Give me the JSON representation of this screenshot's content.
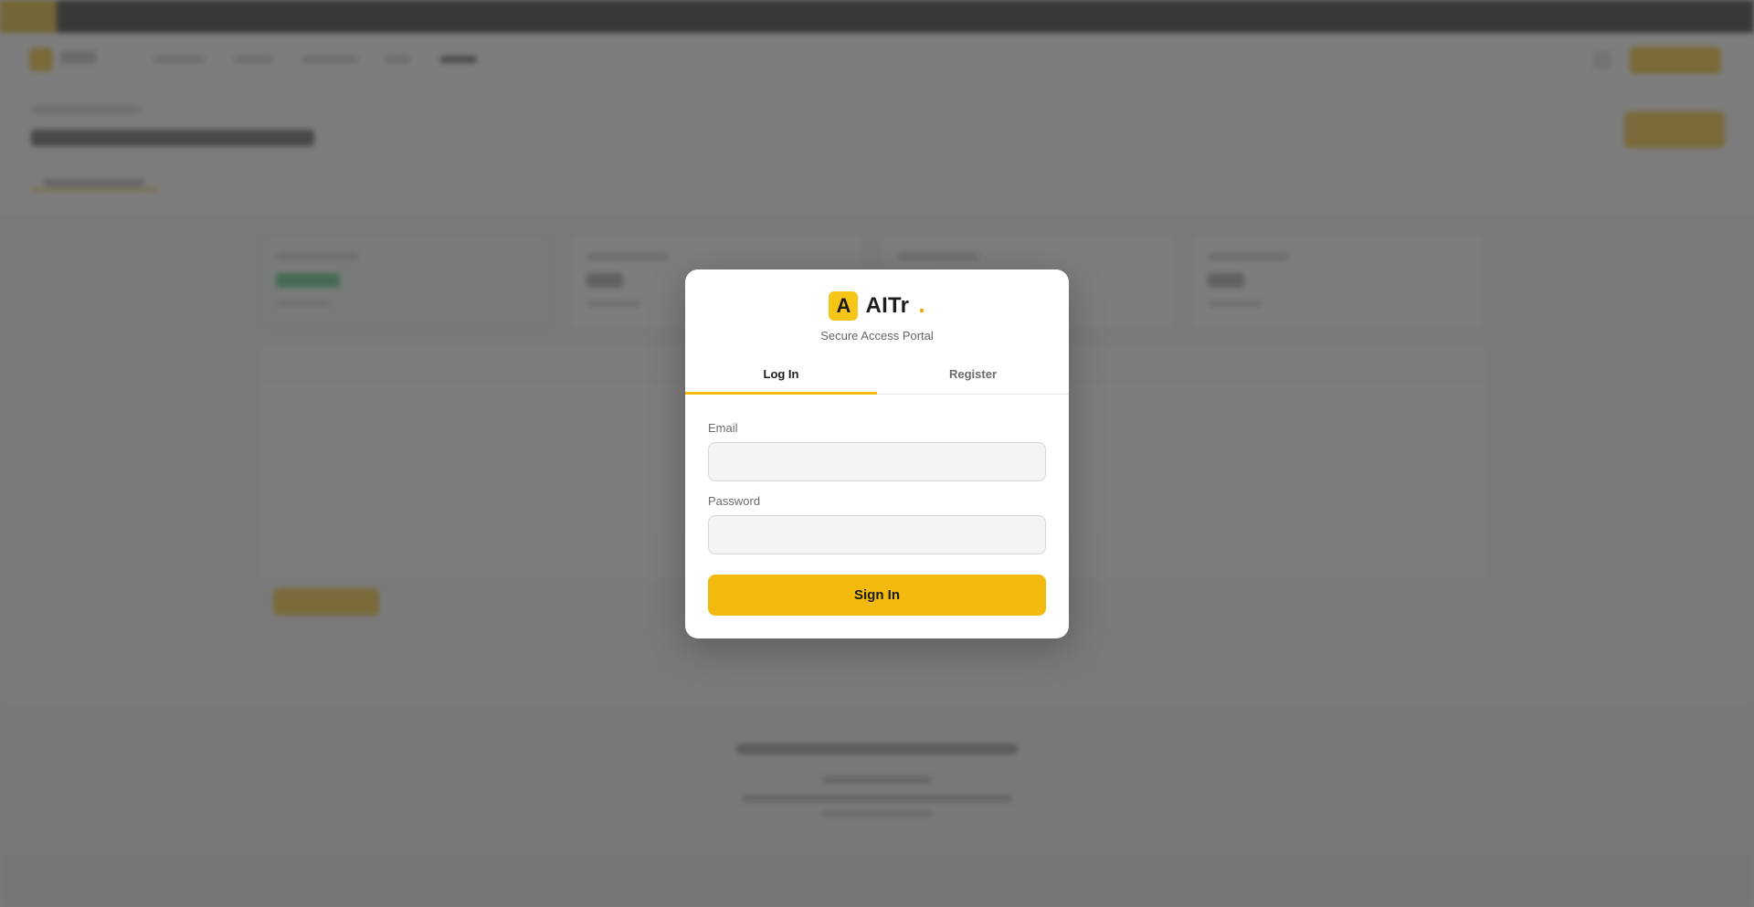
{
  "app": {
    "brand_letter": "A",
    "brand_name": "AITr",
    "brand_dot": ".",
    "subtitle": "Secure Access Portal"
  },
  "tabs": [
    {
      "label": "Log In",
      "active": true
    },
    {
      "label": "Register",
      "active": false
    }
  ],
  "form": {
    "email_label": "Email",
    "email_value": "",
    "email_placeholder": "",
    "password_label": "Password",
    "password_value": "",
    "password_placeholder": "",
    "submit_label": "Sign In"
  },
  "colors": {
    "accent": "#f2b90f",
    "brand_dot": "#f2a800",
    "overlay": "#4b4b4b",
    "success": "#3dbb6b"
  }
}
